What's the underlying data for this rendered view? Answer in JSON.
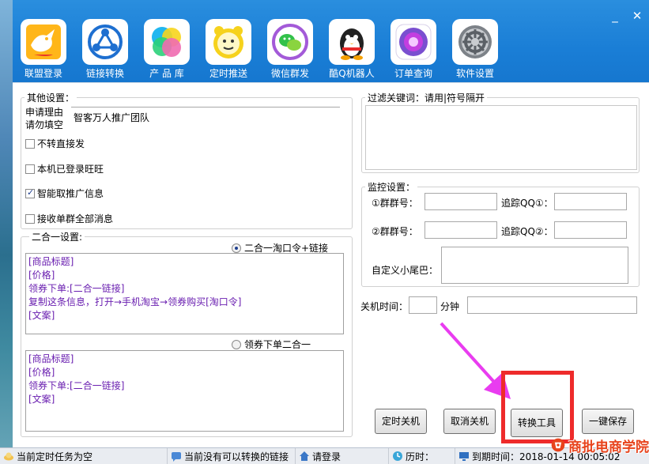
{
  "toolbar": {
    "window_controls": {
      "minimize": "_",
      "close": "✕"
    },
    "items": [
      {
        "label": "联盟登录",
        "icon": "kangaroo-logo-icon"
      },
      {
        "label": "链接转换",
        "icon": "share-nodes-icon"
      },
      {
        "label": "产 品 库",
        "icon": "color-circles-icon"
      },
      {
        "label": "定时推送",
        "icon": "alarm-clock-icon"
      },
      {
        "label": "微信群发",
        "icon": "wechat-icon"
      },
      {
        "label": "酷Q机器人",
        "icon": "qq-penguin-icon"
      },
      {
        "label": "订单查询",
        "icon": "orb-icon"
      },
      {
        "label": "软件设置",
        "icon": "gear-icon"
      }
    ]
  },
  "other_settings": {
    "legend": "其他设置：",
    "reason_label_line1": "申请理由",
    "reason_label_line2": "请勿填空",
    "reason_value": "智客万人推广团队",
    "checkboxes": [
      {
        "label": "不转直接发",
        "checked": false
      },
      {
        "label": "本机已登录旺旺",
        "checked": false
      },
      {
        "label": "智能取推广信息",
        "checked": true
      },
      {
        "label": "接收单群全部消息",
        "checked": false
      }
    ]
  },
  "combo": {
    "legend": "二合一设置:",
    "option1": {
      "label": "二合一淘口令+链接",
      "selected": true
    },
    "template1": [
      "[商品标题]",
      "[价格]",
      "领券下单:[二合一链接]",
      "复制这条信息，打开→手机淘宝→领券购买[淘口令]",
      "[文案]"
    ],
    "option2": {
      "label": "领券下单二合一",
      "selected": false
    },
    "template2": [
      "[商品标题]",
      "[价格]",
      "领券下单:[二合一链接]",
      "[文案]"
    ]
  },
  "filter": {
    "legend": "过滤关键词：请用|符号隔开",
    "value": ""
  },
  "monitor": {
    "legend": "监控设置：",
    "group1_label": "①群群号：",
    "track1_label": "追踪QQ①：",
    "group2_label": "②群群号：",
    "track2_label": "追踪QQ②：",
    "tail_label": "自定义小尾巴："
  },
  "shutdown": {
    "label": "关机时间：",
    "unit": "分钟"
  },
  "buttons": {
    "timed_shutdown": "定时关机",
    "cancel_shutdown": "取消关机",
    "convert_tool": "转换工具",
    "save_all": "一键保存"
  },
  "status": {
    "task": "当前定时任务为空",
    "links": "当前没有可以转换的链接",
    "login": "请登录",
    "time_label": "历时：",
    "expire": "到期时间：2018-01-14 00:05:02"
  },
  "brand": {
    "text": "商批电商学院"
  },
  "colors": {
    "toolbar_blue": "#1a7ed6",
    "template_text": "#6a1fb0",
    "highlight_red": "#ee2b2b",
    "arrow_magenta": "#e93cf0"
  }
}
